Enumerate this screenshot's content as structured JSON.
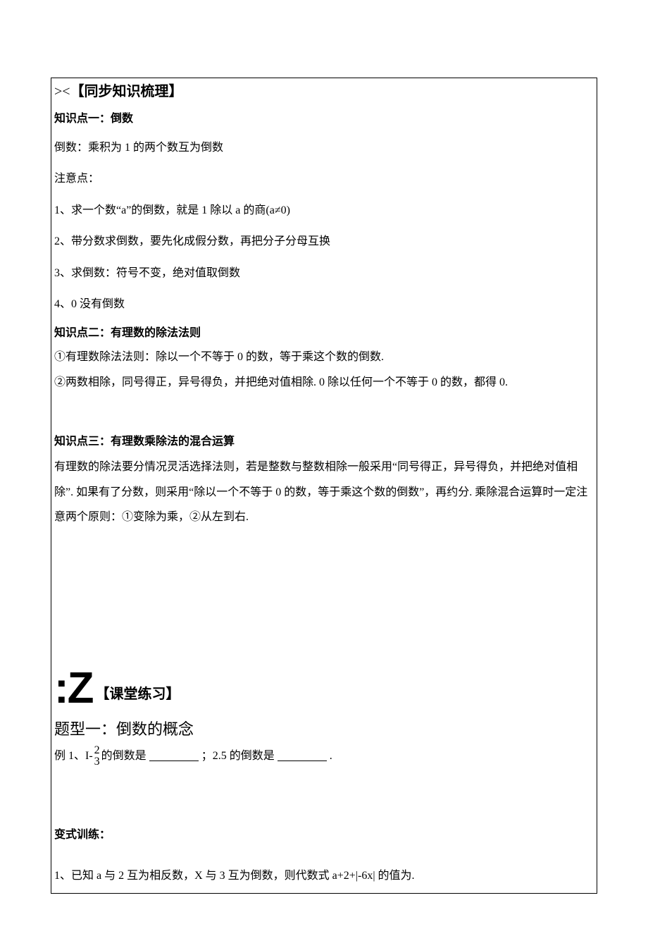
{
  "section1": {
    "icon": "><",
    "title": "【同步知识梳理】"
  },
  "kp1": {
    "title": "知识点一：倒数",
    "def": "倒数：乘积为 1 的两个数互为倒数",
    "note_label": "注意点：",
    "items": {
      "i1": "1、求一个数“a”的倒数，就是 1 除以 a 的商(a≠0)",
      "i2": "2、带分数求倒数，要先化成假分数，再把分子分母互换",
      "i3": "3、求倒数：符号不变，绝对值取倒数",
      "i4": "4、0 没有倒数"
    }
  },
  "kp2": {
    "title": "知识点二：有理数的除法法则",
    "r1": "①有理数除法法则：除以一个不等于 0 的数，等于乘这个数的倒数.",
    "r2": "②两数相除，同号得正，异号得负，并把绝对值相除. 0 除以任何一个不等于 0 的数，都得 0."
  },
  "kp3": {
    "title": "知识点三：有理数乘除法的混合运算",
    "body": "有理数的除法要分情况灵活选择法则，若是整数与整数相除一般采用“同号得正，异号得负，并把绝对值相除”. 如果有了分数，则采用“除以一个不等于 0 的数，等于乘这个数的倒数”，再约分. 乘除混合运算时一定注意两个原则：①变除为乘，②从左到右."
  },
  "section2": {
    "icon": ":Z",
    "title": "【课堂练习】"
  },
  "topic1": {
    "title": "题型一：倒数的概念",
    "ex1_prefix": "例 1、I-",
    "frac_num": "2",
    "frac_den": "3",
    "ex1_mid": "的倒数是 ",
    "ex1_mid2": " ；2.5 的倒数是",
    "ex1_end": "."
  },
  "variation": {
    "title": "变式训练：",
    "q1": "1、已知 a 与 2 互为相反数，X 与 3 互为倒数，则代数式 a+2+|-6x| 的值为."
  }
}
